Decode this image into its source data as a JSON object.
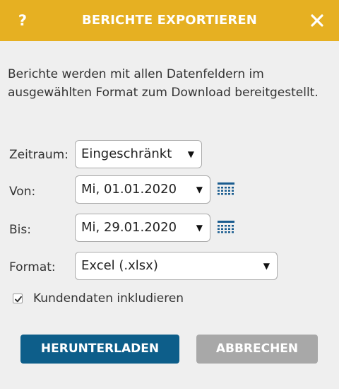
{
  "dialog": {
    "title": "BERICHTE EXPORTIEREN",
    "help_label": "?",
    "close_icon": "close-icon",
    "intro_text": "Berichte werden mit allen Datenfeldern im ausgewählten Format zum Download bereitgestellt.",
    "colors": {
      "header": "#e6b022",
      "primary": "#0d5e8a",
      "secondary": "#a8a8a8",
      "background": "#efefef"
    }
  },
  "form": {
    "zeitraum": {
      "label": "Zeitraum:",
      "value": "Eingeschränkt"
    },
    "von": {
      "label": "Von:",
      "value": "Mi, 01.01.2020",
      "icon": "calendar-icon"
    },
    "bis": {
      "label": "Bis:",
      "value": "Mi, 29.01.2020",
      "icon": "calendar-icon"
    },
    "format": {
      "label": "Format:",
      "value": "Excel (.xlsx)"
    },
    "customer_data": {
      "label": "Kundendaten inkludieren",
      "checked": true
    }
  },
  "buttons": {
    "download": "HERUNTERLADEN",
    "cancel": "ABBRECHEN"
  }
}
